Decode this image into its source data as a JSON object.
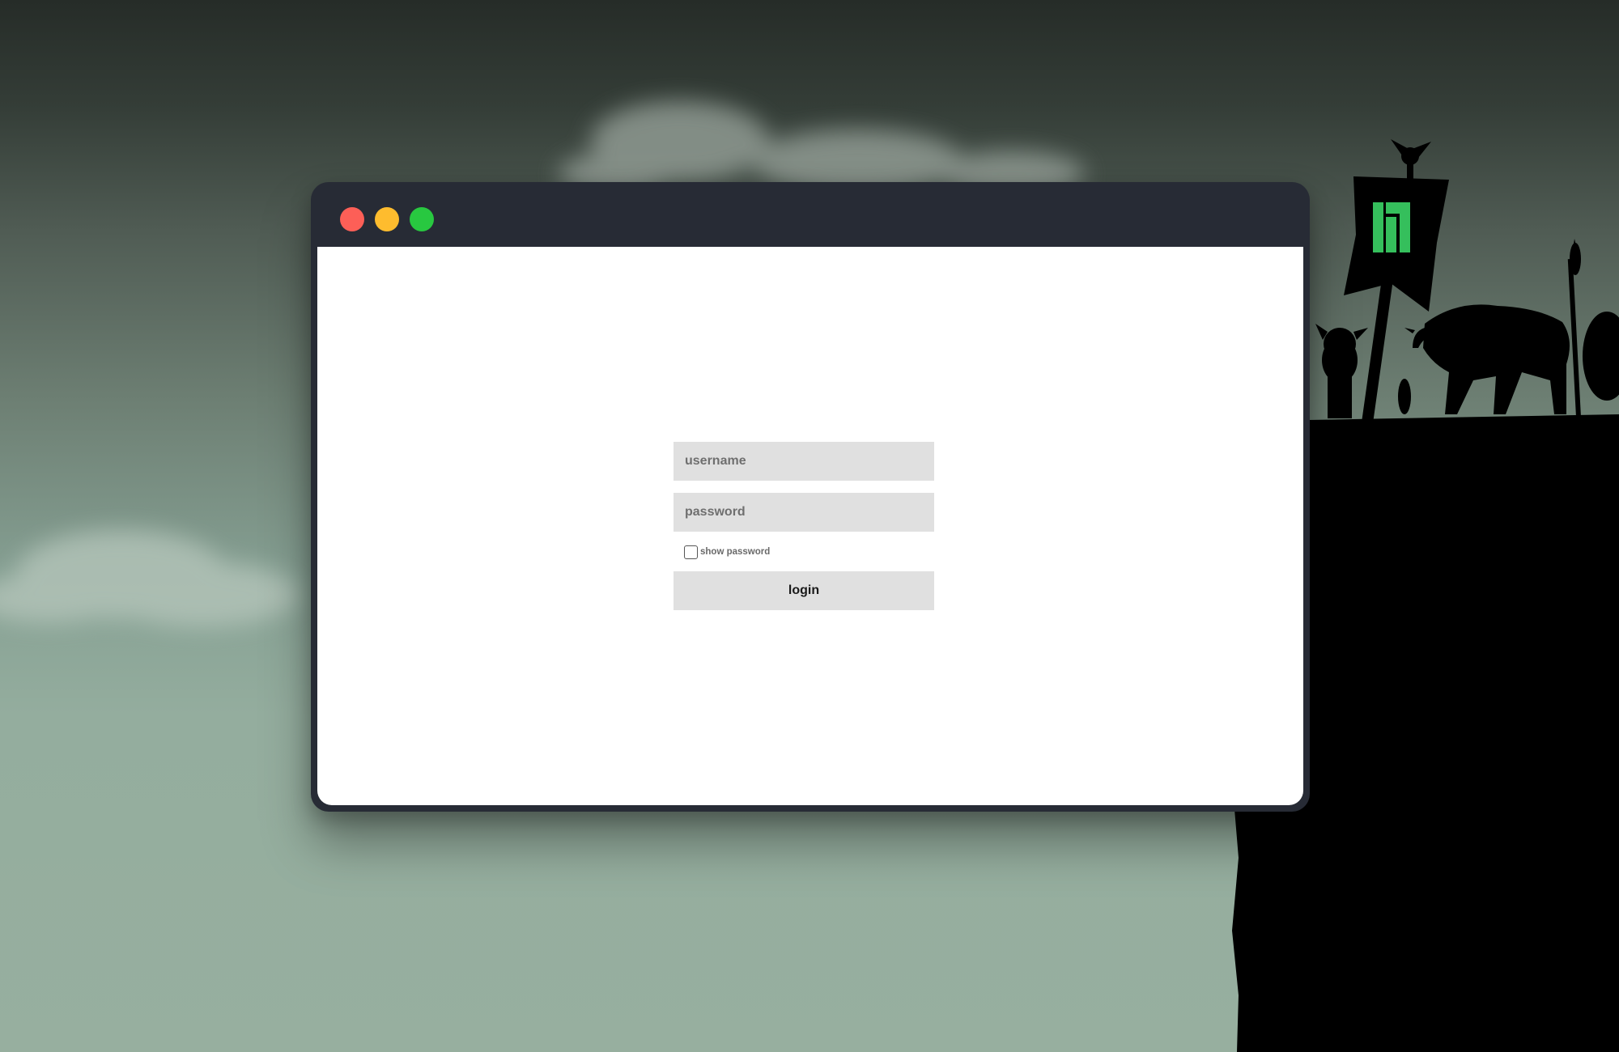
{
  "window": {
    "controls": {
      "close_color": "#fd5f57",
      "minimize_color": "#febc2e",
      "maximize_color": "#28c840"
    }
  },
  "login_form": {
    "username_placeholder": "username",
    "password_placeholder": "password",
    "show_password_label": "show password",
    "login_label": "login"
  },
  "background": {
    "banner_logo": "manjaro-logo",
    "logo_color": "#35bf5c",
    "sky_color": "#97af9f"
  }
}
